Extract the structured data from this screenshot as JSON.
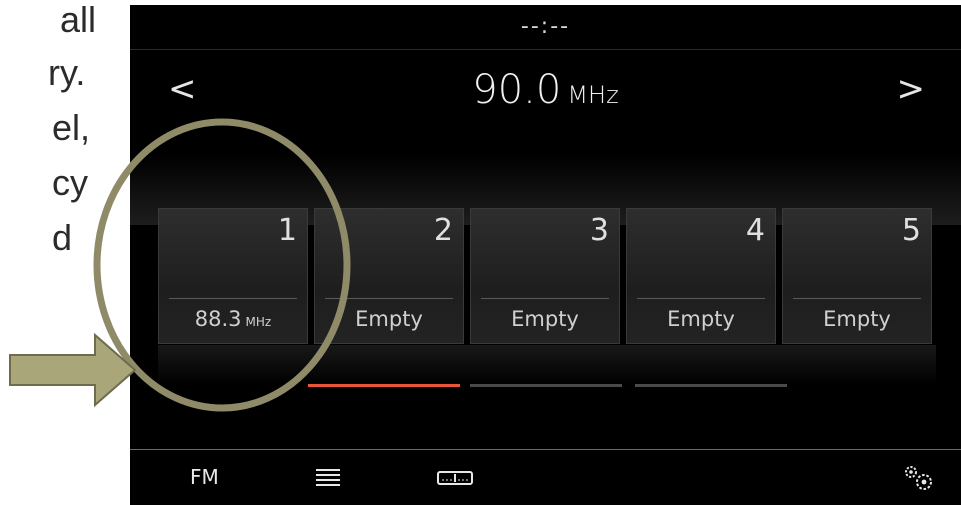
{
  "slide_fragments": [
    "all",
    "ry.",
    "el,",
    "cy",
    "d"
  ],
  "status": {
    "clock": "--:--"
  },
  "tuner": {
    "prev_label": "<",
    "next_label": ">",
    "frequency": "90.0",
    "unit": "MHz"
  },
  "presets": [
    {
      "number": "1",
      "label": "88.3",
      "unit": "MHz"
    },
    {
      "number": "2",
      "label": "Empty"
    },
    {
      "number": "3",
      "label": "Empty"
    },
    {
      "number": "4",
      "label": "Empty"
    },
    {
      "number": "5",
      "label": "Empty"
    }
  ],
  "page_indicator": {
    "pages": 3,
    "active": 1
  },
  "bottom_bar": {
    "band_label": "FM",
    "icons": [
      "list-icon",
      "tuner-scale-icon",
      "settings-gears-icon"
    ]
  },
  "colors": {
    "accent": "#e8543a",
    "screen_bg": "#000000",
    "annotation": "#8f8b68"
  }
}
